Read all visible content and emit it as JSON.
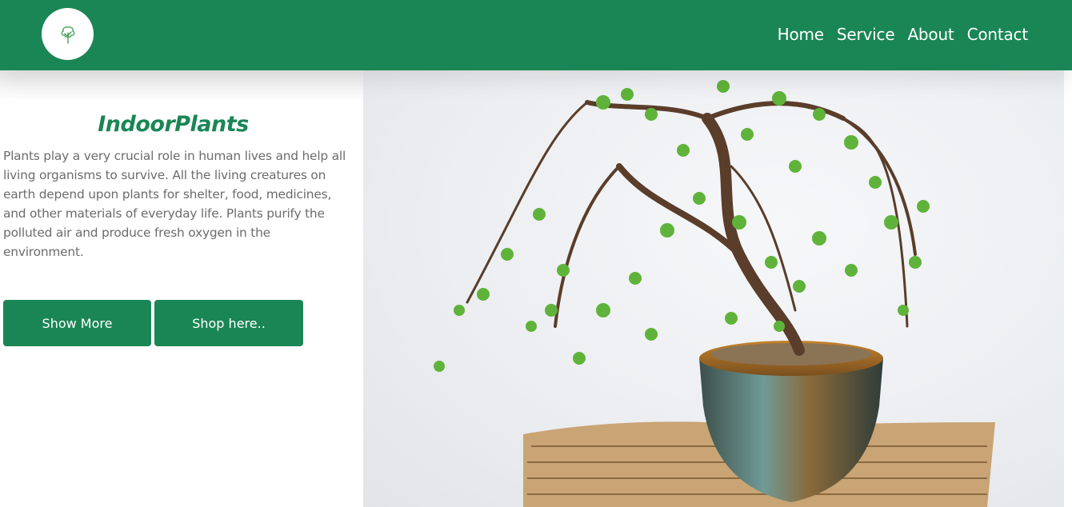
{
  "header": {
    "logo_icon": "tree-icon",
    "nav": [
      {
        "label": "Home"
      },
      {
        "label": "Service"
      },
      {
        "label": "About"
      },
      {
        "label": "Contact"
      }
    ]
  },
  "hero": {
    "title": "IndoorPlants",
    "description": "Plants play a very crucial role in human lives and help all living organisms to survive. All the living creatures on earth depend upon plants for shelter, food, medicines, and other materials of everyday life. Plants purify the polluted air and produce fresh oxygen in the environment.",
    "buttons": {
      "show_more": "Show More",
      "shop": "Shop here.."
    },
    "image_icon": "bonsai-plant-image"
  },
  "colors": {
    "brand": "#1a8655",
    "text_muted": "#6c6c6c",
    "background": "#ffffff"
  }
}
